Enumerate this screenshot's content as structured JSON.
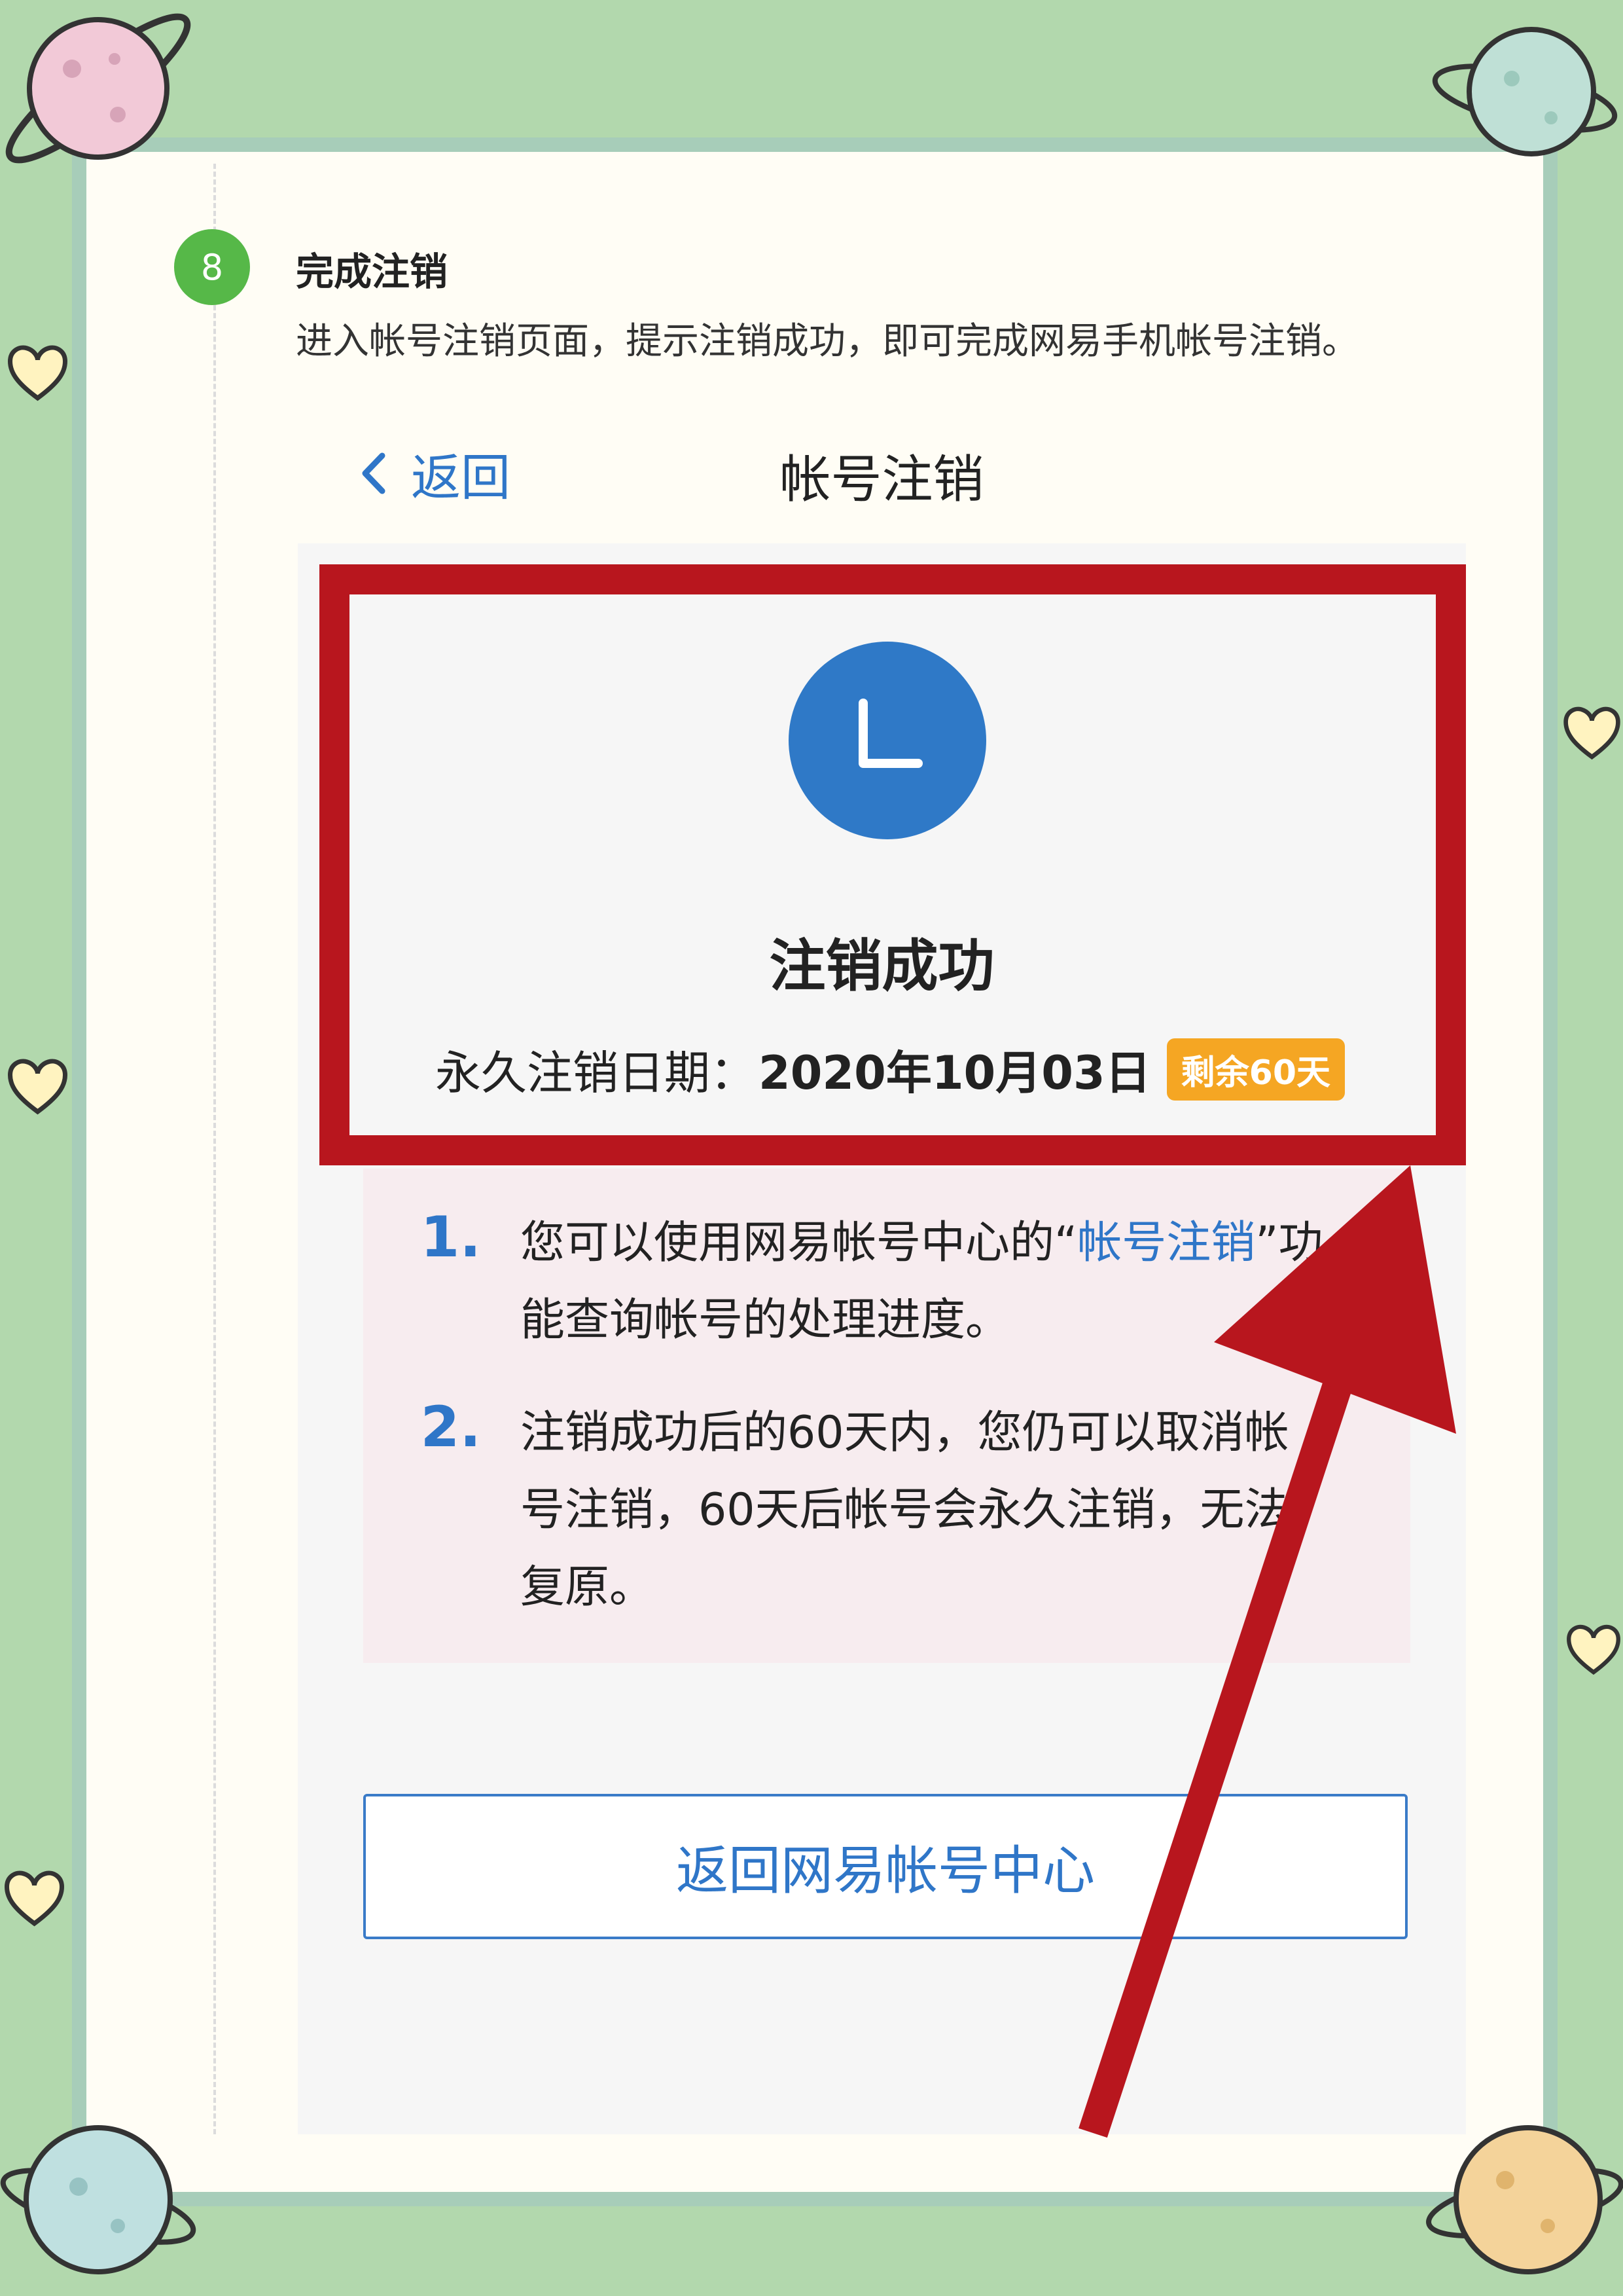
{
  "step": {
    "number": "8",
    "title": "完成注销",
    "description": "进入帐号注销页面，提示注销成功，即可完成网易手机帐号注销。"
  },
  "phone": {
    "back_label": "返回",
    "header_title": "帐号注销",
    "success_title": "注销成功",
    "date_label": "永久注销日期：",
    "date_value": "2020年10月03日",
    "days_badge": "剩余60天",
    "notes": [
      {
        "number": "1.",
        "text_before": "您可以使用网易帐号中心的“",
        "link": "帐号注销",
        "text_after": "”功能查询帐号的处理进度。"
      },
      {
        "number": "2.",
        "text": "注销成功后的60天内，您仍可以取消帐号注销，60天后帐号会永久注销，无法复原。"
      }
    ],
    "return_button": "返回网易帐号中心"
  },
  "colors": {
    "background": "#b2d8ad",
    "step_badge": "#56b848",
    "accent_blue": "#2f76c8",
    "annotation_red": "#b8161e",
    "badge_orange": "#f5a623"
  },
  "icons": [
    "chevron-left-icon",
    "clock-icon",
    "annotation-arrow",
    "planet-decoration",
    "heart-decoration"
  ]
}
